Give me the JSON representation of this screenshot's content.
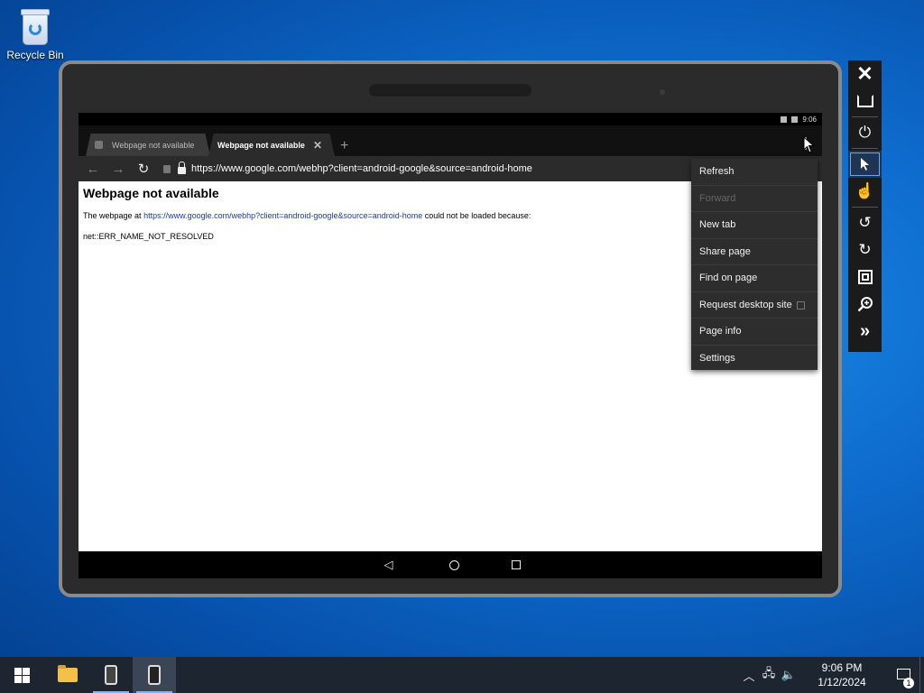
{
  "desktop": {
    "recycle_bin_label": "Recycle Bin"
  },
  "android": {
    "status_time": "9:06",
    "tabs": [
      {
        "title": "Webpage not available",
        "active": false
      },
      {
        "title": "Webpage not available",
        "active": true
      }
    ],
    "url": "https://www.google.com/webhp?client=android-google&source=android-home",
    "page": {
      "heading": "Webpage not available",
      "text_before_link": "The webpage at ",
      "link": "https://www.google.com/webhp?client=android-google&source=android-home",
      "text_after_link": " could not be loaded because:",
      "error_code": "net::ERR_NAME_NOT_RESOLVED"
    },
    "menu": {
      "refresh": "Refresh",
      "forward": "Forward",
      "new_tab": "New tab",
      "share_page": "Share page",
      "find_on_page": "Find on page",
      "request_desktop_site": "Request desktop site",
      "page_info": "Page info",
      "settings": "Settings"
    }
  },
  "taskbar": {
    "time": "9:06 PM",
    "date": "1/12/2024",
    "notification_count": "1"
  },
  "colors": {
    "accent": "#6da4e8",
    "link": "#1a33cc",
    "taskbar": "#1c2530"
  }
}
